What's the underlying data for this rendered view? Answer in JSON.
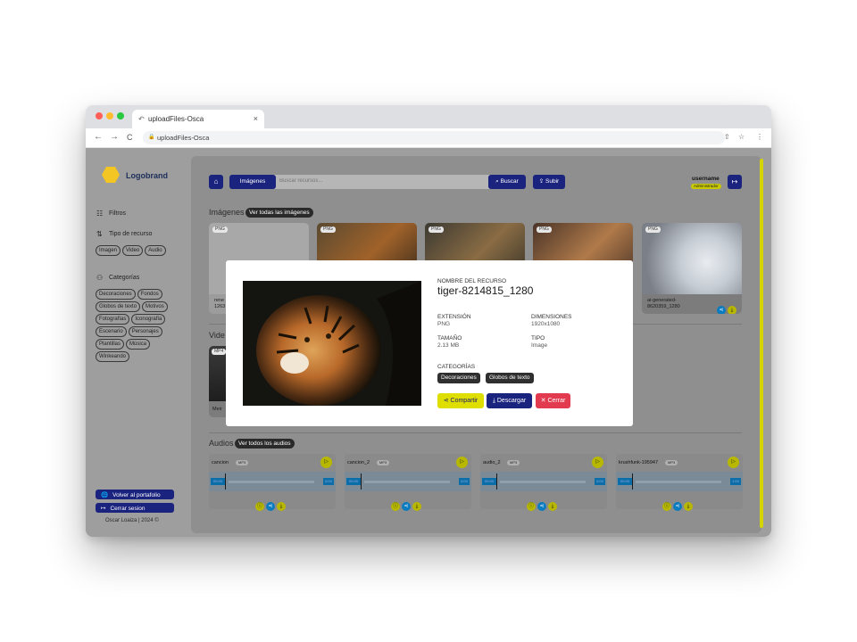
{
  "browser": {
    "tab_title": "uploadFiles-Osca",
    "tab_close": "×",
    "url": "uploadFiles-Osca",
    "nav_back": "←",
    "nav_forward": "→",
    "nav_reload": "C"
  },
  "sidebar": {
    "brand": "Logobrand",
    "filters_label": "Filtros",
    "resource_type_label": "Tipo de recurso",
    "resource_types": [
      "Imagen",
      "Video",
      "Audio"
    ],
    "categories_label": "Categorías",
    "categories": [
      "Decoraciones",
      "Fondos",
      "Globos de texto",
      "Motivos",
      "Fotografías",
      "Iconografía",
      "Escenario",
      "Personajes",
      "Plantillas",
      "Música",
      "Winkeando"
    ],
    "portfolio_button": "Volver al portafolio",
    "logout_button": "Cerrar sesion",
    "footer": "Oscar Loaiza | 2024 ©"
  },
  "topbar": {
    "resource_select": "Imágenes",
    "search_placeholder": "Buscar recursos...",
    "search_button": "Buscar",
    "upload_button": "Subir",
    "username": "username",
    "role": "Administrador"
  },
  "images_section": {
    "title": "Imágenes",
    "see_all": "Ver todas las imágenes",
    "cards": [
      {
        "badge": "PNG",
        "name_line1": "rene",
        "name_line2": "1263"
      },
      {
        "badge": "PNG",
        "name_line1": "",
        "name_line2": ""
      },
      {
        "badge": "PNG",
        "name_line1": "",
        "name_line2": ""
      },
      {
        "badge": "PNG",
        "name_line1": "",
        "name_line2": ""
      },
      {
        "badge": "PNG",
        "name_line1": "ai-generated-",
        "name_line2": "8620359_1280"
      }
    ]
  },
  "videos_section": {
    "title": "Vide",
    "badge": "MP4",
    "name": "Meir"
  },
  "audios_section": {
    "title": "Audios",
    "see_all": "Ver todos los audios",
    "items": [
      {
        "name": "cancion",
        "format": "MP3",
        "time_start": "00:00",
        "time_end": "0:00"
      },
      {
        "name": "cancion_2",
        "format": "MP3",
        "time_start": "00:00",
        "time_end": "0:00"
      },
      {
        "name": "audio_2",
        "format": "MP3",
        "time_start": "00:00",
        "time_end": "0:00"
      },
      {
        "name": "krushfunk-195947",
        "format": "MP3",
        "time_start": "00:00",
        "time_end": "1:00"
      }
    ]
  },
  "modal": {
    "name_label": "NOMBRE DEL RECURSO",
    "name_value": "tiger-8214815_1280",
    "extension_label": "EXTENSIÓN",
    "extension_value": "PNG",
    "dimensions_label": "DIMENSIONES",
    "dimensions_value": "1920x1080",
    "size_label": "TAMAÑO",
    "size_value": "2.13 MB",
    "type_label": "TIPO",
    "type_value": "Image",
    "categories_label": "CATEGORÍAS",
    "categories": [
      "Decoraciones",
      "Globos de texto"
    ],
    "share_button": "Compartir",
    "download_button": "Descargar",
    "close_button": "Cerrar"
  },
  "colors": {
    "primary": "#1a237e",
    "accent_yellow": "#dede00",
    "danger": "#e23b50",
    "overlay_gray": "#9e9e9e"
  }
}
